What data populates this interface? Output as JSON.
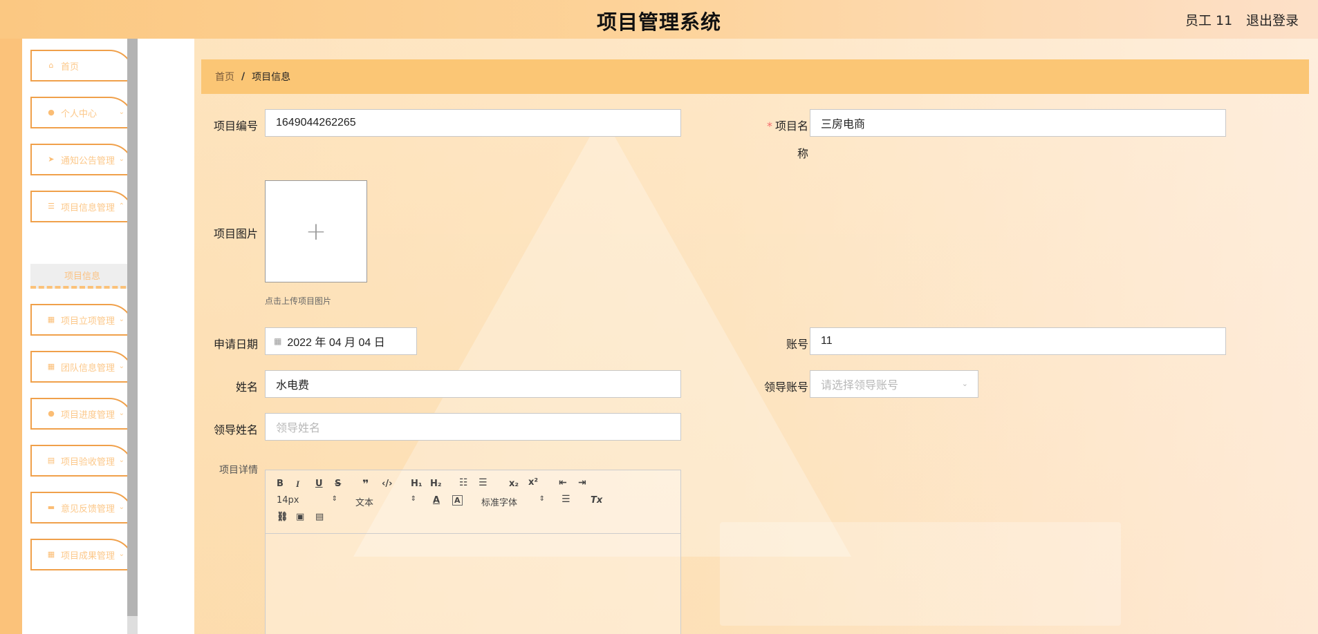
{
  "header": {
    "title": "项目管理系统",
    "user": "员工 11",
    "logout": "退出登录"
  },
  "sidebar": {
    "items": [
      {
        "label": "首页",
        "icon": "home-icon"
      },
      {
        "label": "个人中心",
        "icon": "user-icon"
      },
      {
        "label": "通知公告管理",
        "icon": "send-icon"
      },
      {
        "label": "项目信息管理",
        "icon": "list-icon"
      },
      {
        "label": "项目立项管理",
        "icon": "grid-icon"
      },
      {
        "label": "团队信息管理",
        "icon": "grid-icon"
      },
      {
        "label": "项目进度管理",
        "icon": "user-icon"
      },
      {
        "label": "项目验收管理",
        "icon": "doc-icon"
      },
      {
        "label": "意见反馈管理",
        "icon": "monitor-icon"
      },
      {
        "label": "项目成果管理",
        "icon": "grid-icon"
      }
    ],
    "submenu": "项目信息"
  },
  "breadcrumb": {
    "home": "首页",
    "sep": "/",
    "current": "项目信息"
  },
  "form": {
    "project_no_label": "项目编号",
    "project_no": "1649044262265",
    "project_name_label_1": "项目名",
    "project_name_label_2": "称",
    "project_name": "三房电商",
    "image_label": "项目图片",
    "upload_plus": "+",
    "upload_tip": "点击上传项目图片",
    "date_label": "申请日期",
    "date": "2022 年 04 月 04 日",
    "account_label": "账号",
    "account": "11",
    "name_label": "姓名",
    "name": "水电费",
    "leader_account_label": "领导账号",
    "leader_account_placeholder": "请选择领导账号",
    "leader_name_label": "领导姓名",
    "leader_name_placeholder": "领导姓名",
    "details_label": "项目详情"
  },
  "editor": {
    "font_size": "14px",
    "header_select": "文本",
    "font_select": "标准字体"
  },
  "colors": {
    "accent": "#fbc675",
    "border": "#f0a04a",
    "required": "#f56c6c"
  }
}
